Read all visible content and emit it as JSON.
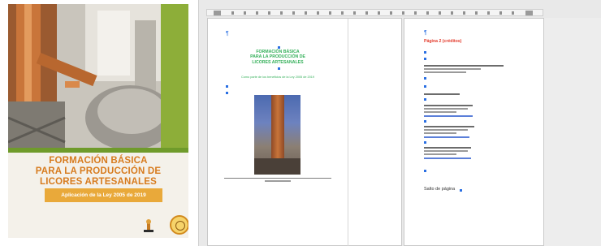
{
  "cover": {
    "title_lines": [
      "FORMACIÓN BÁSICA",
      "PARA LA PRODUCCIÓN DE",
      "LICORES ARTESANALES"
    ],
    "ribbon": "Aplicación de la Ley 2005 de 2019",
    "colors": {
      "accent_green": "#8dae39",
      "title_orange": "#d77b1e",
      "ribbon_gold": "#e9a93a"
    }
  },
  "editor": {
    "left_page": {
      "title_lines": [
        "FORMACIÓN BÁSICA",
        "PARA LA PRODUCCIÓN DE",
        "LICORES ARTESANALES"
      ],
      "subtitle": "Como parte de los beneficios de la Ley 2005 de 2019"
    },
    "right_page": {
      "heading": "Página 2 (créditos)",
      "page_break": "Salto de página"
    },
    "marker_icon": "paragraph-mark-icon"
  }
}
